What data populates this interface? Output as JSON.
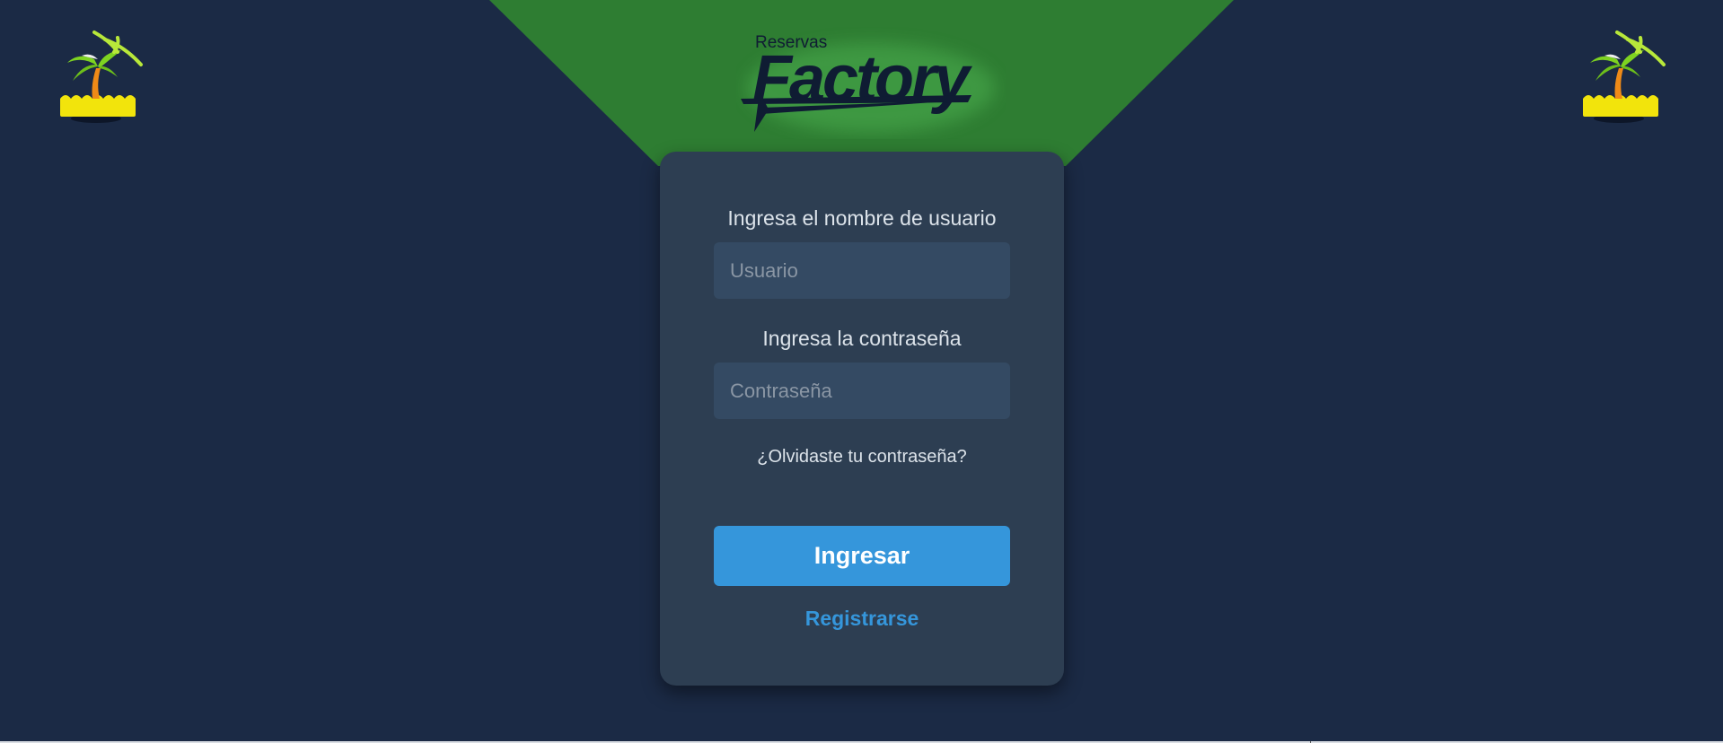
{
  "header": {
    "logo_small_text": "Reservas",
    "logo_large_text": "Factory"
  },
  "login": {
    "username_label": "Ingresa el nombre de usuario",
    "username_placeholder": "Usuario",
    "username_value": "",
    "password_label": "Ingresa la contraseña",
    "password_placeholder": "Contraseña",
    "password_value": "",
    "forgot_link": "¿Olvidaste tu contraseña?",
    "submit_label": "Ingresar",
    "register_link": "Registrarse"
  },
  "icons": {
    "left_decoration": "palm-island-icon",
    "right_decoration": "palm-island-icon"
  },
  "colors": {
    "background": "#1b2a45",
    "header_wedge": "#2e7d32",
    "card": "#2d3e52",
    "input": "#344a63",
    "accent": "#3596db",
    "logo_text": "#0f1c33"
  }
}
